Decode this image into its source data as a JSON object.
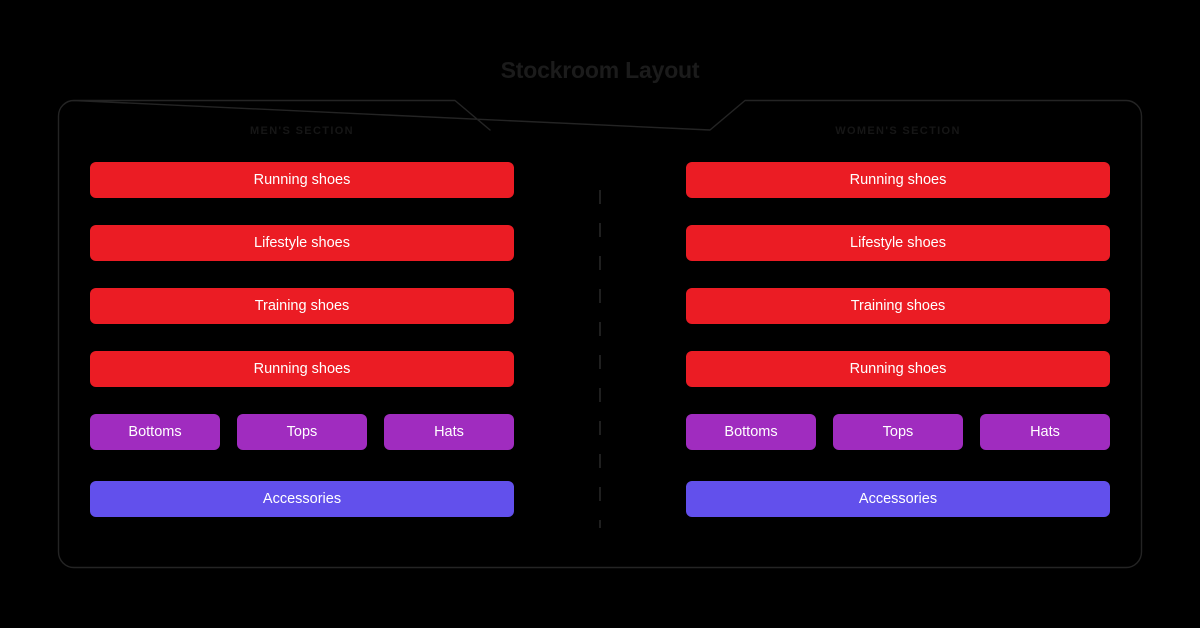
{
  "page": {
    "title": "Stockroom Layout",
    "background_color": "#000000",
    "title_color": "#1b1b1b"
  },
  "frame": {
    "border_color": "#242424",
    "corner_radius": 16,
    "notch": "top-center-trapezoid-gap"
  },
  "divider": {
    "name": "center-dashed-divider",
    "color": "#1f1f1f",
    "style": "dashed"
  },
  "palette": {
    "shoes": "#eb1c24",
    "apparel": "#a02cbf",
    "accessories": "#6250ec",
    "label": "#ffffff"
  },
  "sections": [
    {
      "id": "mens",
      "header": "MEN'S SECTION",
      "shoe_bars": [
        {
          "label": "Running shoes"
        },
        {
          "label": "Lifestyle shoes"
        },
        {
          "label": "Training shoes"
        },
        {
          "label": "Running shoes"
        }
      ],
      "apparel": [
        {
          "label": "Bottoms"
        },
        {
          "label": "Tops"
        },
        {
          "label": "Hats"
        }
      ],
      "accessories": {
        "label": "Accessories"
      }
    },
    {
      "id": "womens",
      "header": "WOMEN'S SECTION",
      "shoe_bars": [
        {
          "label": "Running shoes"
        },
        {
          "label": "Lifestyle shoes"
        },
        {
          "label": "Training shoes"
        },
        {
          "label": "Running shoes"
        }
      ],
      "apparel": [
        {
          "label": "Bottoms"
        },
        {
          "label": "Tops"
        },
        {
          "label": "Hats"
        }
      ],
      "accessories": {
        "label": "Accessories"
      }
    }
  ]
}
